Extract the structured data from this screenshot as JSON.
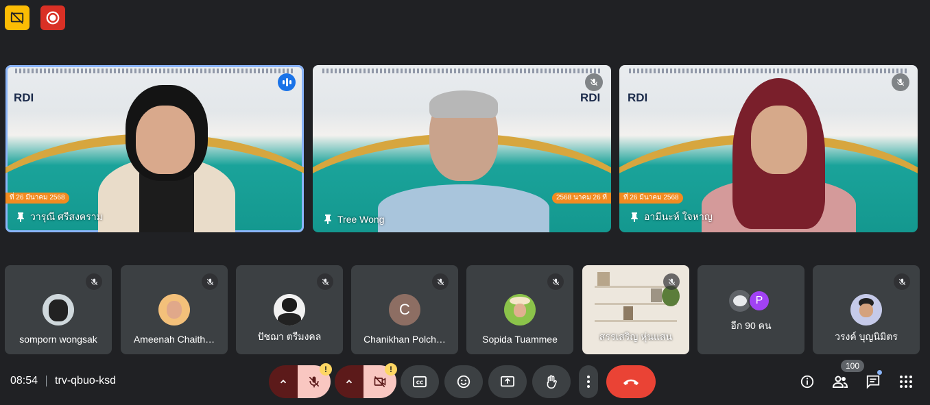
{
  "status_badges": [
    {
      "icon": "no-broadcast-icon",
      "color": "#fbbc04"
    },
    {
      "icon": "recording-icon",
      "color": "#d93025"
    }
  ],
  "presenters": [
    {
      "name": "วารุณี ศรีสงคราม",
      "date_text": "ที่ 26 มีนาคม 2568",
      "brand": "RDI",
      "speaking": true
    },
    {
      "name": "Tree Wong",
      "date_text": "2568 นาคม 26 ที่",
      "brand": "RDI",
      "speaking": false
    },
    {
      "name": "อามีนะห์ ใจหาญ",
      "date_text": "ที่ 26 มีนาคม 2568",
      "brand": "RDI",
      "speaking": false
    }
  ],
  "participants": [
    {
      "name": "somporn wongsak"
    },
    {
      "name": "Ameenah Chaith…"
    },
    {
      "name": "ปัชฌา ตรีมงคล"
    },
    {
      "name": "Chanikhan Polch…",
      "initial": "C"
    },
    {
      "name": "Sopida Tuammee"
    },
    {
      "name": "สรรเสริญ หุ่นแสน"
    },
    {
      "name": "อีก 90 คน",
      "initial": "P"
    },
    {
      "name": "วรงค์ บุญนิมิตร"
    }
  ],
  "meeting": {
    "time": "08:54",
    "code": "trv-qbuo-ksd"
  },
  "controls": {
    "warn_mark": "!",
    "participant_count": "100"
  },
  "colors": {
    "background": "#202124",
    "tile": "#3c4043",
    "end_call": "#ea4335",
    "active_outline": "#8ab4f8"
  }
}
